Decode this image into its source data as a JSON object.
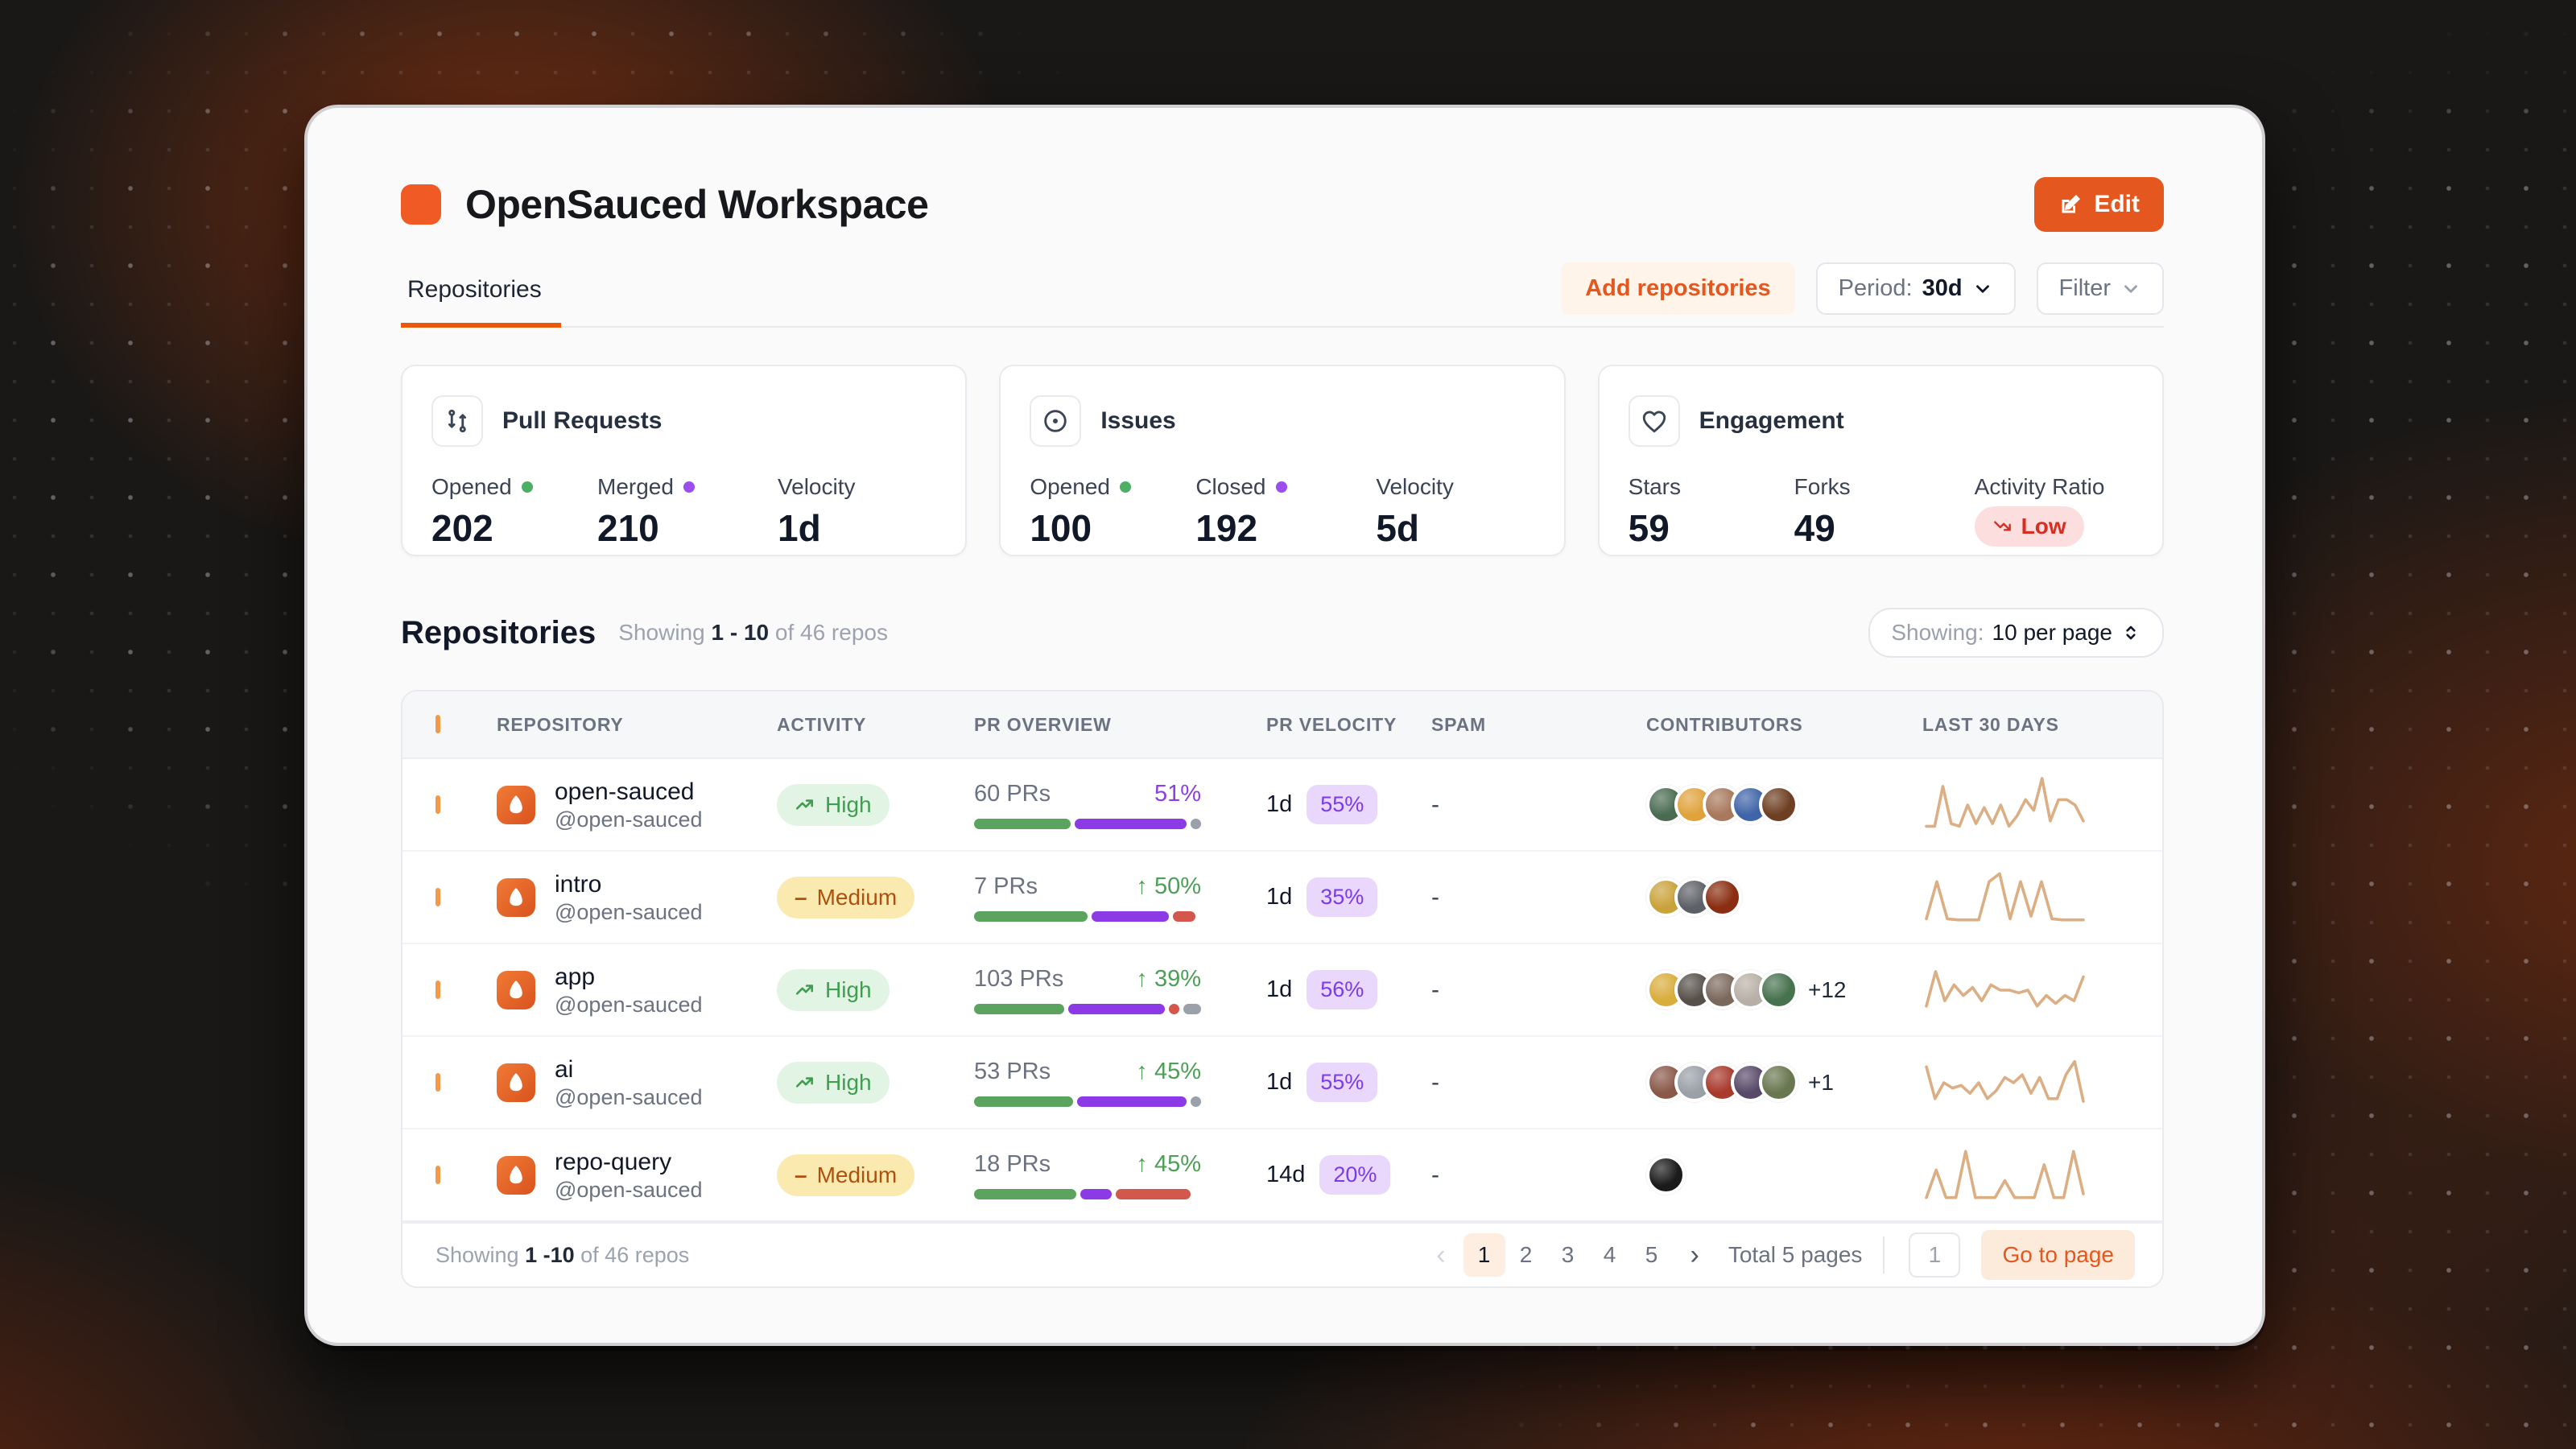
{
  "window": {
    "title": "OpenSauced Workspace",
    "edit_label": "Edit"
  },
  "tabs": {
    "active": "Repositories"
  },
  "toolbar": {
    "add_repositories": "Add repositories",
    "period_label": "Period:",
    "period_value": "30d",
    "filter_label": "Filter"
  },
  "stat_cards": [
    {
      "title": "Pull Requests",
      "stats": [
        {
          "label": "Opened",
          "dot": "green",
          "value": "202"
        },
        {
          "label": "Merged",
          "dot": "purple",
          "value": "210"
        },
        {
          "label": "Velocity",
          "value": "1d"
        }
      ]
    },
    {
      "title": "Issues",
      "stats": [
        {
          "label": "Opened",
          "dot": "green",
          "value": "100"
        },
        {
          "label": "Closed",
          "dot": "purple",
          "value": "192"
        },
        {
          "label": "Velocity",
          "value": "5d"
        }
      ]
    },
    {
      "title": "Engagement",
      "stats": [
        {
          "label": "Stars",
          "value": "59"
        },
        {
          "label": "Forks",
          "value": "49"
        },
        {
          "label": "Activity Ratio",
          "badge": "Low"
        }
      ]
    }
  ],
  "section": {
    "heading": "Repositories",
    "showing_prefix": "Showing",
    "showing_range": "1 - 10",
    "showing_suffix": "of 46 repos",
    "per_page_label": "Showing:",
    "per_page_value": "10 per page"
  },
  "table": {
    "columns": [
      "REPOSITORY",
      "ACTIVITY",
      "PR OVERVIEW",
      "PR VELOCITY",
      "SPAM",
      "CONTRIBUTORS",
      "LAST 30 DAYS"
    ],
    "rows": [
      {
        "name": "open-sauced",
        "handle": "@open-sauced",
        "activity": "High",
        "prs": "60 PRs",
        "change": "51%",
        "change_tone": "purple",
        "change_arrow": false,
        "bar": [
          [
            "green",
            44
          ],
          [
            "purple",
            51
          ],
          [
            "dot",
            "gray"
          ]
        ],
        "velocity": "1d",
        "velocity_pct": "55%",
        "spam": "-",
        "avatars": [
          "#4a6b52",
          "#e0a33c",
          "#a8795c",
          "#3f64a8",
          "#6e3f22"
        ],
        "extra": "",
        "spark": [
          1,
          1,
          8.5,
          1.5,
          1,
          5,
          1.5,
          4.5,
          1.5,
          5,
          1,
          3,
          6,
          4,
          10,
          2,
          6,
          6,
          5,
          2
        ]
      },
      {
        "name": "intro",
        "handle": "@open-sauced",
        "activity": "Medium",
        "prs": "7 PRs",
        "change": "50%",
        "change_tone": "green",
        "change_arrow": true,
        "bar": [
          [
            "green",
            50
          ],
          [
            "purple",
            34
          ],
          [
            "red",
            10
          ]
        ],
        "velocity": "1d",
        "velocity_pct": "35%",
        "spam": "-",
        "avatars": [
          "#caa23a",
          "#5d6066",
          "#8a2d10"
        ],
        "extra": "",
        "spark": [
          1,
          8,
          1,
          0.8,
          0.8,
          0.8,
          8,
          9.5,
          1,
          8,
          1.5,
          8,
          1,
          0.8,
          0.8,
          0.8
        ]
      },
      {
        "name": "app",
        "handle": "@open-sauced",
        "activity": "High",
        "prs": "103 PRs",
        "change": "39%",
        "change_tone": "green",
        "change_arrow": true,
        "bar": [
          [
            "green",
            40
          ],
          [
            "purple",
            43
          ],
          [
            "dot",
            "red"
          ],
          [
            "gray",
            8
          ]
        ],
        "velocity": "1d",
        "velocity_pct": "56%",
        "spam": "-",
        "avatars": [
          "#d9ad3c",
          "#57504a",
          "#7a685c",
          "#b8b0a6",
          "#47724e"
        ],
        "extra": "+12",
        "spark": [
          2,
          8.5,
          3,
          6,
          4,
          5.5,
          3,
          6,
          5,
          5,
          4.5,
          5,
          2,
          4,
          2.5,
          4,
          3,
          7.5
        ]
      },
      {
        "name": "ai",
        "handle": "@open-sauced",
        "activity": "High",
        "prs": "53 PRs",
        "change": "45%",
        "change_tone": "green",
        "change_arrow": true,
        "bar": [
          [
            "green",
            45
          ],
          [
            "purple",
            50
          ],
          [
            "dot",
            "gray"
          ]
        ],
        "velocity": "1d",
        "velocity_pct": "55%",
        "spam": "-",
        "avatars": [
          "#8a5848",
          "#9aa0a8",
          "#a8392c",
          "#584968",
          "#68774f"
        ],
        "extra": "+1",
        "spark": [
          8,
          2,
          5,
          4,
          4.5,
          3,
          5,
          2,
          3.5,
          6,
          5,
          6.5,
          3,
          6,
          2,
          2,
          6.5,
          9,
          1.5
        ]
      },
      {
        "name": "repo-query",
        "handle": "@open-sauced",
        "activity": "Medium",
        "prs": "18 PRs",
        "change": "45%",
        "change_tone": "green",
        "change_arrow": true,
        "bar": [
          [
            "green",
            45
          ],
          [
            "purple",
            14
          ],
          [
            "red",
            33
          ]
        ],
        "velocity": "14d",
        "velocity_pct": "20%",
        "spam": "-",
        "avatars": [
          "#1b1b1b"
        ],
        "extra": "",
        "spark": [
          0.8,
          6,
          0.8,
          0.8,
          9.5,
          0.8,
          0.8,
          0.8,
          4,
          0.8,
          0.8,
          0.8,
          7,
          0.8,
          0.8,
          9.5,
          1.5
        ]
      }
    ]
  },
  "footer": {
    "showing_prefix": "Showing",
    "showing_range": "1 -10",
    "showing_suffix": "of 46 repos",
    "pages": [
      "1",
      "2",
      "3",
      "4",
      "5"
    ],
    "active_page": "1",
    "total_label": "Total 5 pages",
    "goto_value": "1",
    "goto_label": "Go to page"
  },
  "colors": {
    "accent": "#ea580c",
    "bar_green": "#5ba35f",
    "bar_purple": "#8b3ae6",
    "bar_red": "#d4574e",
    "bar_gray": "#9aa1ab",
    "sparkline": "#dcae84",
    "velocity_bg": "#e9d8fc",
    "velocity_text": "#7c3aed"
  }
}
